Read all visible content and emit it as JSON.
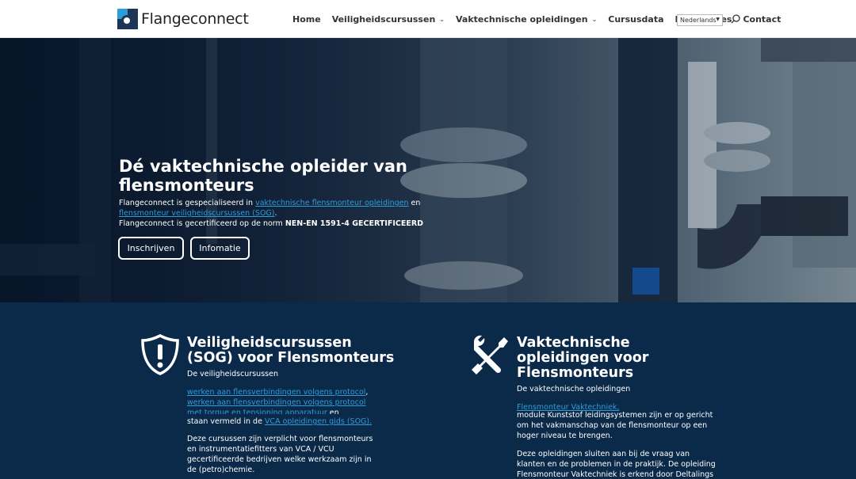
{
  "header": {
    "logo_text": "Flangeconnect",
    "nav": [
      {
        "label": "Home",
        "dropdown": false
      },
      {
        "label": "Veiligheidscursussen",
        "dropdown": true
      },
      {
        "label": "Vaktechnische opleidingen",
        "dropdown": true
      },
      {
        "label": "Cursusdata",
        "dropdown": false
      },
      {
        "label": "Referenties",
        "dropdown": false
      },
      {
        "label": "Contact",
        "dropdown": false
      }
    ],
    "language": "Nederlands",
    "search_icon": "search-icon"
  },
  "hero": {
    "title": "Dé vaktechnische opleider van flensmonteurs",
    "desc_prefix": "Flangeconnect is gespecialiseerd in ",
    "link1": "vaktechnische flensmonteur opleidingen",
    "desc_and": " en ",
    "link2": "flensmonteur veiligheidscursussen (SOG)",
    "desc_dot": ".",
    "cert_prefix": "Flangeconnect is gecertificeerd op  de norm ",
    "cert_bold": "NEN-EN 1591-4 GECERTIFICEERD",
    "btn_signup": "Inschrijven",
    "btn_info": "Infomatie"
  },
  "col1": {
    "icon": "shield-exclamation-icon",
    "title": "Veiligheidscursussen (SOG) voor Flensmonteurs",
    "subtitle": "De veiligheidscursussen",
    "link_a": "werken aan flensverbindingen volgens protocol",
    "comma": ",",
    "link_b": "werken aan flensverbindingen volgens protocol met torque en tensioning apparatuur",
    "en": " en",
    "vca_prefix": "staan vermeld in de ",
    "vca_link": "VCA opleidingen gids (SOG).",
    "para": "Deze cursussen zijn verplicht voor flensmonteurs en instrumentatiefitters van VCA / VCU gecertificeerde bedrijven welke werkzaam zijn in de (petro)chemie."
  },
  "col2": {
    "icon": "wrench-screwdriver-icon",
    "title": "Vaktechnische opleidingen voor Flensmonteurs",
    "subtitle": "De vaktechnische opleidingen",
    "link": "Flensmonteur Vaktechniek,",
    "para1": "module Kunststof leidingsystemen zijn er op gericht om het vakmanschap van de flensmonteur op een hoger niveau te brengen.",
    "para2": "Deze opleidingen sluiten aan bij de vraag van klanten en de problemen in de praktijk. De opleiding Flensmonteur Vaktechniek is erkend door Deltalings en staat in de"
  },
  "colors": {
    "navy": "#0b2a4a",
    "link_blue": "#2d9cdb"
  }
}
